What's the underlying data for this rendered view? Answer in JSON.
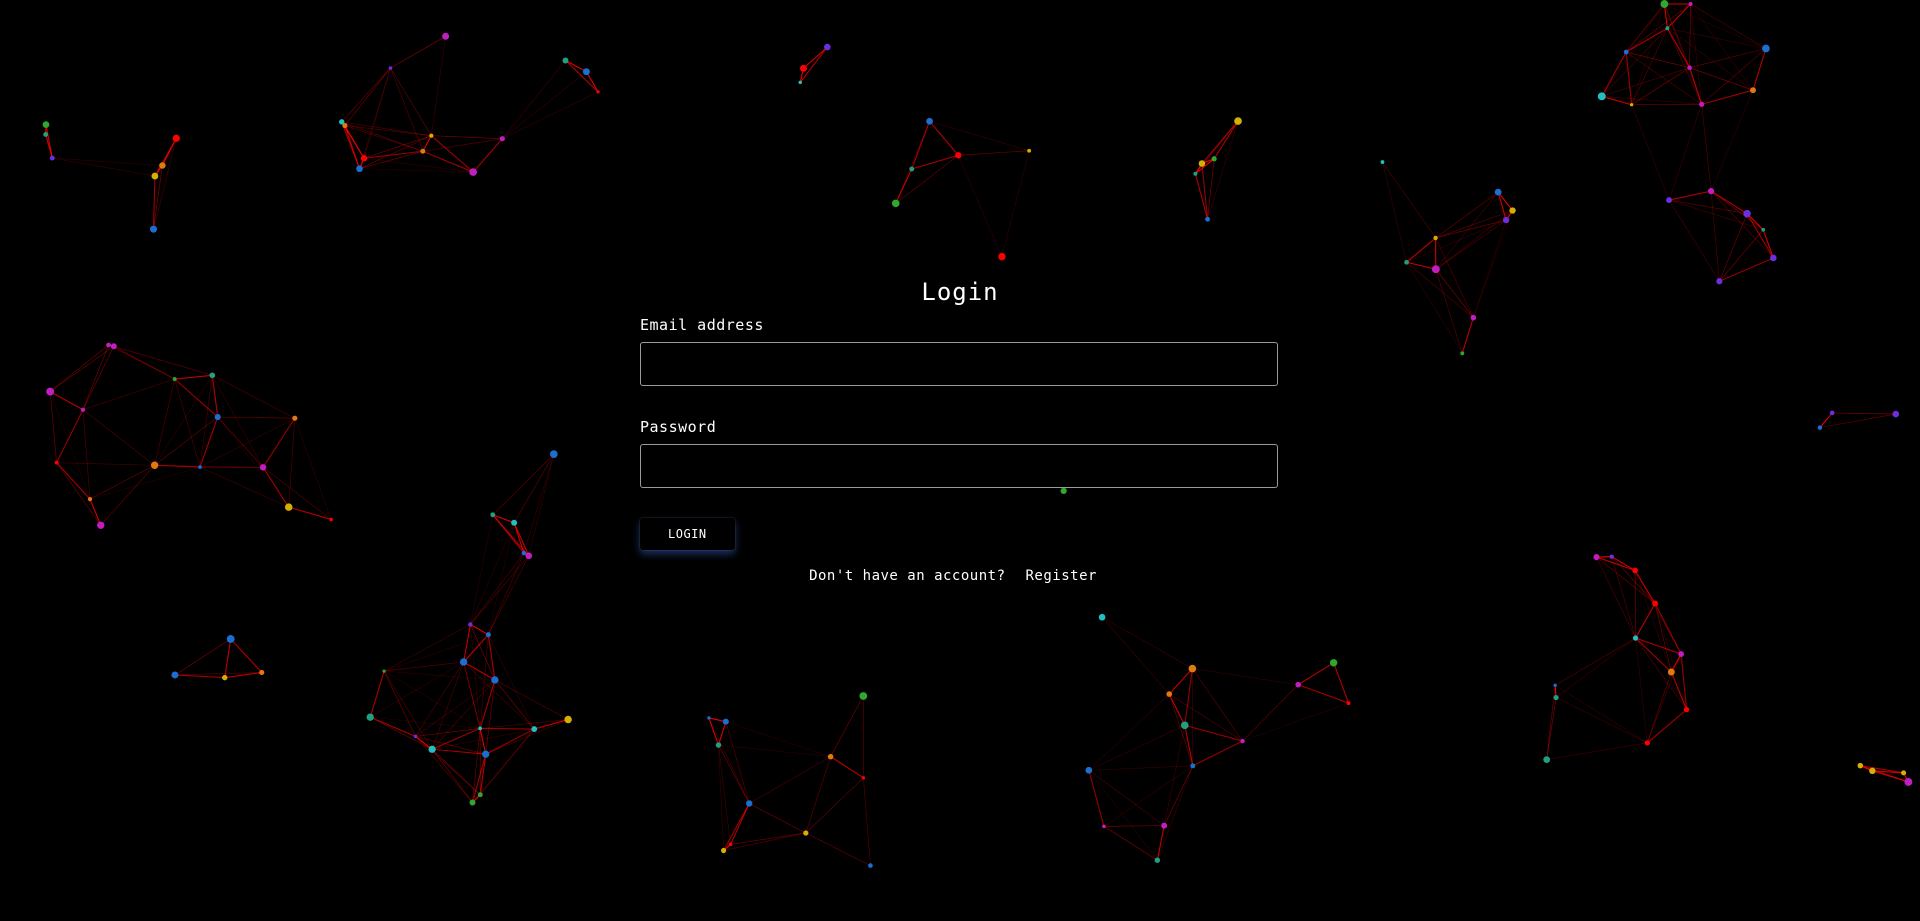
{
  "login": {
    "title": "Login",
    "email_label": "Email address",
    "email_value": "",
    "email_placeholder": "",
    "password_label": "Password",
    "password_value": "",
    "password_placeholder": "",
    "submit_label": "LOGIN",
    "no_account_text": "Don't have an account?",
    "register_link": "Register"
  },
  "colors": {
    "background": "#000000",
    "line": "#ff0000",
    "text": "#ffffff",
    "input_border": "#9a9a9a",
    "button_glow": "#3c6edc",
    "node_palette": [
      "#ff0000",
      "#1a6fd0",
      "#2ea82e",
      "#c01ec0",
      "#e07a10",
      "#d4b000",
      "#20c0c0",
      "#6a30e0",
      "#20a080"
    ]
  }
}
